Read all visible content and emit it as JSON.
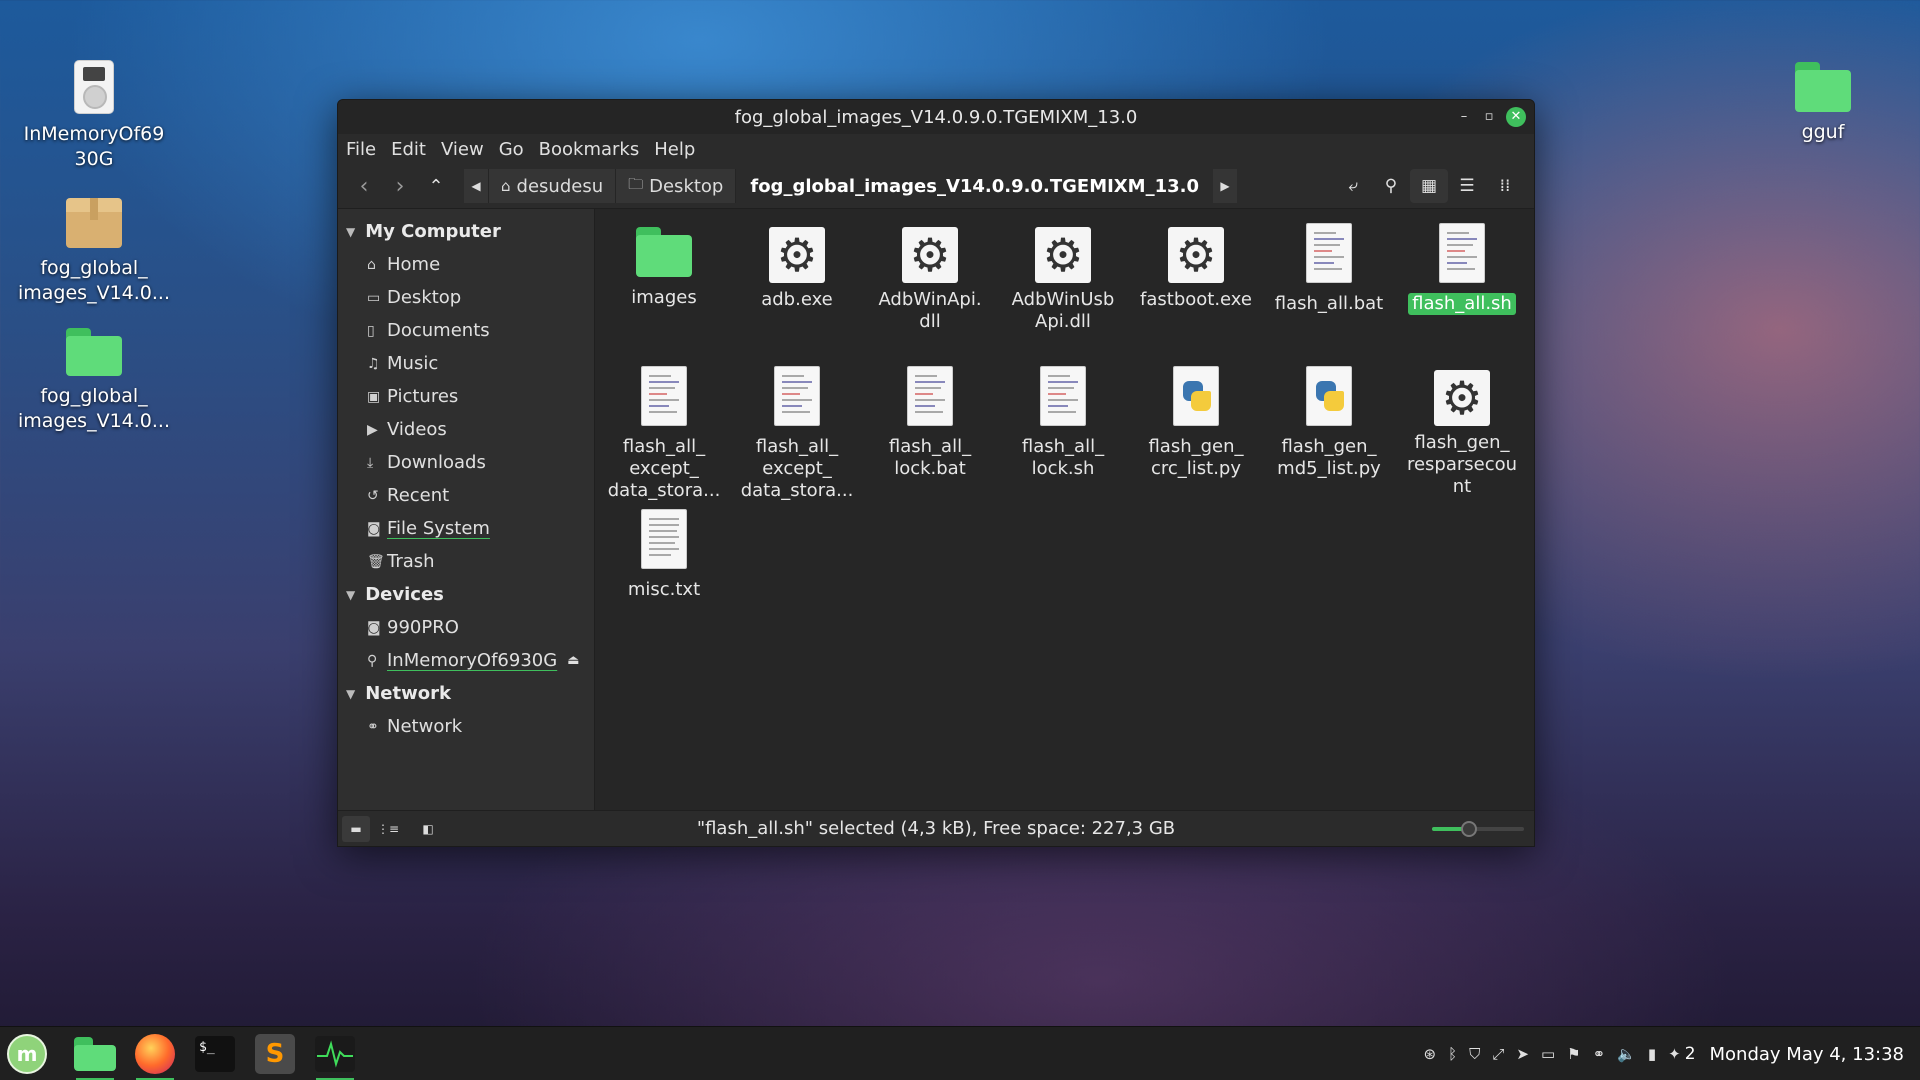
{
  "desktop": {
    "icons": [
      {
        "label": "InMemoryOf69\n30G",
        "line1": "InMemoryOf69",
        "line2": "30G",
        "icon": "drive-icon"
      },
      {
        "line1": "fog_global_",
        "line2": "images_V14.0...",
        "icon": "archive-icon"
      },
      {
        "line1": "fog_global_",
        "line2": "images_V14.0...",
        "icon": "folder-icon"
      },
      {
        "line1": "gguf",
        "line2": "",
        "icon": "folder-icon"
      }
    ]
  },
  "window": {
    "title": "fog_global_images_V14.0.9.0.TGEMIXM_13.0",
    "controls": {
      "minimize": "–",
      "maximize": "▫",
      "close": "✕"
    }
  },
  "menubar": {
    "items": [
      "File",
      "Edit",
      "View",
      "Go",
      "Bookmarks",
      "Help"
    ]
  },
  "toolbar": {
    "breadcrumbs": [
      "desudesu",
      "Desktop",
      "fog_global_images_V14.0.9.0.TGEMIXM_13.0"
    ],
    "view_mode": "icon-view"
  },
  "sidebar": {
    "sections": [
      {
        "title": "My Computer",
        "items": [
          {
            "label": "Home",
            "icon": "home-icon"
          },
          {
            "label": "Desktop",
            "icon": "folder-icon"
          },
          {
            "label": "Documents",
            "icon": "document-icon"
          },
          {
            "label": "Music",
            "icon": "music-icon"
          },
          {
            "label": "Pictures",
            "icon": "picture-icon"
          },
          {
            "label": "Videos",
            "icon": "video-icon"
          },
          {
            "label": "Downloads",
            "icon": "download-icon"
          },
          {
            "label": "Recent",
            "icon": "recent-icon"
          },
          {
            "label": "File System",
            "icon": "drive-icon"
          },
          {
            "label": "Trash",
            "icon": "trash-icon"
          }
        ]
      },
      {
        "title": "Devices",
        "items": [
          {
            "label": "990PRO",
            "icon": "drive-icon"
          },
          {
            "label": "InMemoryOf6930G",
            "icon": "usb-icon"
          }
        ]
      },
      {
        "title": "Network",
        "items": [
          {
            "label": "Network",
            "icon": "network-icon"
          }
        ]
      }
    ]
  },
  "files": [
    {
      "line1": "images",
      "line2": "",
      "line3": "",
      "type": "folder"
    },
    {
      "line1": "adb.exe",
      "line2": "",
      "line3": "",
      "type": "gear"
    },
    {
      "line1": "AdbWinApi.",
      "line2": "dll",
      "line3": "",
      "type": "gear"
    },
    {
      "line1": "AdbWinUsb",
      "line2": "Api.dll",
      "line3": "",
      "type": "gear"
    },
    {
      "line1": "fastboot.exe",
      "line2": "",
      "line3": "",
      "type": "gear"
    },
    {
      "line1": "flash_all.bat",
      "line2": "",
      "line3": "",
      "type": "doc"
    },
    {
      "line1": "flash_all.sh",
      "line2": "",
      "line3": "",
      "type": "doc",
      "selected": true
    },
    {
      "line1": "flash_all_",
      "line2": "except_",
      "line3": "data_stora...",
      "type": "doc"
    },
    {
      "line1": "flash_all_",
      "line2": "except_",
      "line3": "data_stora...",
      "type": "doc"
    },
    {
      "line1": "flash_all_",
      "line2": "lock.bat",
      "line3": "",
      "type": "doc"
    },
    {
      "line1": "flash_all_",
      "line2": "lock.sh",
      "line3": "",
      "type": "doc"
    },
    {
      "line1": "flash_gen_",
      "line2": "crc_list.py",
      "line3": "",
      "type": "py"
    },
    {
      "line1": "flash_gen_",
      "line2": "md5_list.py",
      "line3": "",
      "type": "py"
    },
    {
      "line1": "flash_gen_",
      "line2": "resparsecou",
      "line3": "nt",
      "type": "gear"
    },
    {
      "line1": "misc.txt",
      "line2": "",
      "line3": "",
      "type": "doc"
    }
  ],
  "status": {
    "text": "\"flash_all.sh\" selected (4,3 kB), Free space: 227,3 GB",
    "zoom_fraction": 0.4
  },
  "taskbar": {
    "apps": [
      "mint-menu-icon",
      "files-icon",
      "firefox-icon",
      "terminal-icon",
      "sublime-icon",
      "system-monitor-icon"
    ],
    "tray_count": "2",
    "clock": "Monday May 4, 13:38"
  },
  "colors": {
    "accent": "#3fbf5d",
    "window_bg": "#2b2b2b",
    "files_bg": "#262626"
  }
}
